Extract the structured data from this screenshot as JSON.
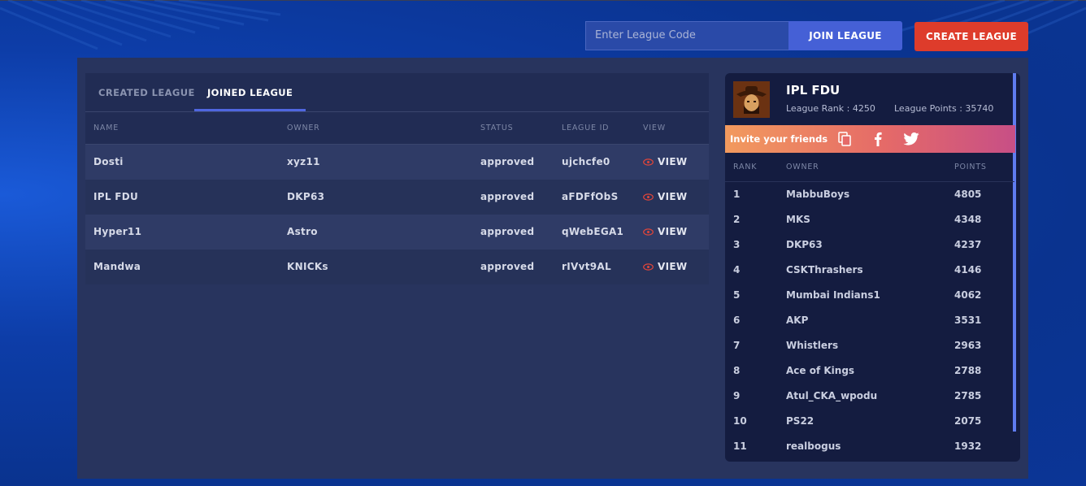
{
  "header": {
    "league_code_placeholder": "Enter League Code",
    "join_label": "JOIN LEAGUE",
    "create_label": "CREATE LEAGUE"
  },
  "tabs": [
    {
      "label": "CREATED LEAGUE",
      "active": false
    },
    {
      "label": "JOINED LEAGUE",
      "active": true
    }
  ],
  "table": {
    "columns": [
      "NAME",
      "OWNER",
      "STATUS",
      "LEAGUE ID",
      "VIEW"
    ],
    "rows": [
      {
        "name": "Dosti",
        "owner": "xyz11",
        "status": "approved",
        "league_id": "ujchcfe0",
        "view": "VIEW"
      },
      {
        "name": "IPL FDU",
        "owner": "DKP63",
        "status": "approved",
        "league_id": "aFDFfObS",
        "view": "VIEW"
      },
      {
        "name": "Hyper11",
        "owner": "Astro",
        "status": "approved",
        "league_id": "qWebEGA1",
        "view": "VIEW"
      },
      {
        "name": "Mandwa",
        "owner": "KNICKs",
        "status": "approved",
        "league_id": "rIVvt9AL",
        "view": "VIEW"
      }
    ]
  },
  "league_card": {
    "title": "IPL FDU",
    "rank_text": "League Rank : 4250",
    "points_text": "League Points : 35740",
    "invite_text": "Invite your friends",
    "invite_icons": [
      "copy-icon",
      "facebook-icon",
      "twitter-icon"
    ],
    "columns": [
      "RANK",
      "OWNER",
      "POINTS"
    ],
    "leaderboard": [
      {
        "rank": "1",
        "owner": "MabbuBoys",
        "points": "4805"
      },
      {
        "rank": "2",
        "owner": "MKS",
        "points": "4348"
      },
      {
        "rank": "3",
        "owner": "DKP63",
        "points": "4237"
      },
      {
        "rank": "4",
        "owner": "CSKThrashers",
        "points": "4146"
      },
      {
        "rank": "5",
        "owner": "Mumbai Indians1",
        "points": "4062"
      },
      {
        "rank": "6",
        "owner": "AKP",
        "points": "3531"
      },
      {
        "rank": "7",
        "owner": "Whistlers",
        "points": "2963"
      },
      {
        "rank": "8",
        "owner": "Ace of Kings",
        "points": "2788"
      },
      {
        "rank": "9",
        "owner": "Atul_CKA_wpodu",
        "points": "2785"
      },
      {
        "rank": "10",
        "owner": "PS22",
        "points": "2075"
      },
      {
        "rank": "11",
        "owner": "realbogus",
        "points": "1932"
      }
    ]
  },
  "colors": {
    "accent": "#4f66e0",
    "create_button": "#de3c2b",
    "view_icon": "#e0453a"
  }
}
